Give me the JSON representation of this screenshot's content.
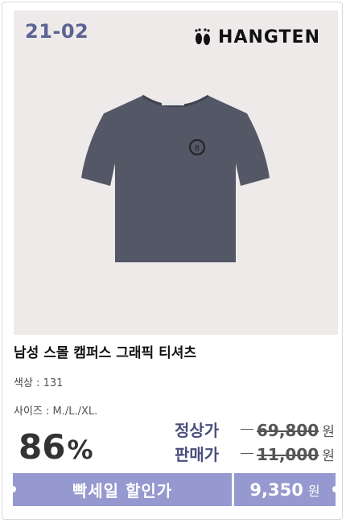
{
  "code": "21-02",
  "brand": "HANGTEN",
  "product_name": "남성 스몰 캠퍼스 그래픽 티셔츠",
  "color": {
    "label": "색상 :",
    "value": "131"
  },
  "size": {
    "label": "사이즈 :",
    "value": "M./L./XL."
  },
  "discount": {
    "value": "86",
    "symbol": "%"
  },
  "regular_price": {
    "label": "정상가",
    "value": "69,800",
    "unit": "원"
  },
  "sale_price": {
    "label": "판매가",
    "value": "11,000",
    "unit": "원"
  },
  "banner": {
    "label": "빡세일 할인가",
    "price": "9,350",
    "unit": "원"
  },
  "colors": {
    "accent": "#9599cf",
    "code": "#5b6394",
    "shirt": "#545766"
  }
}
